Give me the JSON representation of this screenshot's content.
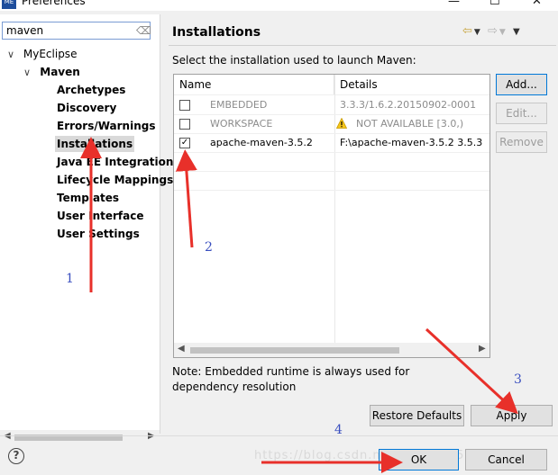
{
  "window": {
    "title": "Preferences",
    "app_icon_label": "ME",
    "minimize": "—",
    "maximize": "☐",
    "close": "✕"
  },
  "sidebar": {
    "filter_value": "maven",
    "tree": [
      {
        "label": "MyEclipse",
        "twisty": "∨"
      },
      {
        "label": "Maven",
        "twisty": "∨"
      },
      {
        "label": "Archetypes"
      },
      {
        "label": "Discovery"
      },
      {
        "label": "Errors/Warnings"
      },
      {
        "label": "Installations",
        "selected": true
      },
      {
        "label": "Java EE Integration"
      },
      {
        "label": "Lifecycle Mappings"
      },
      {
        "label": "Templates"
      },
      {
        "label": "User Interface"
      },
      {
        "label": "User Settings"
      }
    ]
  },
  "page": {
    "title": "Installations",
    "instruction": "Select the installation used to launch Maven:",
    "table": {
      "columns": [
        "Name",
        "Details"
      ],
      "rows": [
        {
          "checked": false,
          "name": "EMBEDDED",
          "details": "3.3.3/1.6.2.20150902-0001",
          "dimmed": true
        },
        {
          "checked": false,
          "name": "WORKSPACE",
          "details": "NOT AVAILABLE [3.0,)",
          "dimmed": true,
          "warning": true
        },
        {
          "checked": true,
          "name": "apache-maven-3.5.2",
          "details": "F:\\apache-maven-3.5.2 3.5.3",
          "dimmed": false
        }
      ]
    },
    "buttons": {
      "add": "Add...",
      "edit": "Edit...",
      "remove": "Remove"
    },
    "note": "Note: Embedded runtime is always used for dependency resolution",
    "restore_defaults": "Restore Defaults",
    "apply": "Apply"
  },
  "footer": {
    "ok": "OK",
    "cancel": "Cancel",
    "help": "?"
  },
  "watermark": "https://blog.csdn.net/qq_40915763",
  "annotations": [
    "1",
    "2",
    "3",
    "4"
  ],
  "colors": {
    "arrow": "#e8302a",
    "annotation_text": "#3a4fbf",
    "focus_border": "#0078d7"
  }
}
